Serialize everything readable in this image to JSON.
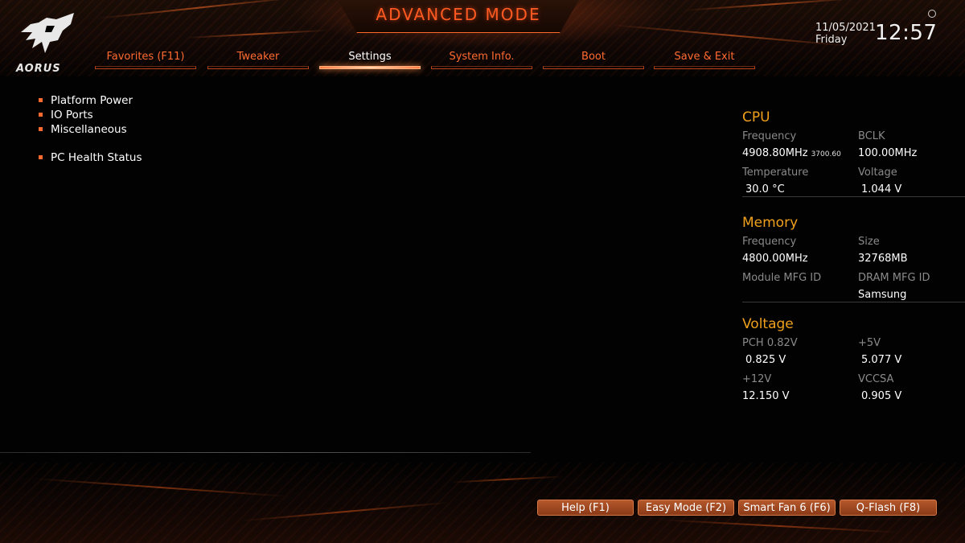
{
  "header": {
    "mode_title": "ADVANCED MODE",
    "brand": "AORUS",
    "date": "11/05/2021",
    "day": "Friday",
    "time": "12:57"
  },
  "tabs": [
    {
      "label": "Favorites (F11)",
      "active": false
    },
    {
      "label": "Tweaker",
      "active": false
    },
    {
      "label": "Settings",
      "active": true
    },
    {
      "label": "System Info.",
      "active": false
    },
    {
      "label": "Boot",
      "active": false
    },
    {
      "label": "Save & Exit",
      "active": false
    }
  ],
  "menu": {
    "items": [
      {
        "label": "Platform Power"
      },
      {
        "label": "IO Ports"
      },
      {
        "label": "Miscellaneous"
      },
      {
        "label": "PC Health Status"
      }
    ]
  },
  "panel": {
    "cpu": {
      "title": "CPU",
      "frequency_label": "Frequency",
      "frequency_value": "4908.80MHz",
      "frequency_sub": "3700.60",
      "bclk_label": "BCLK",
      "bclk_value": "100.00MHz",
      "temperature_label": "Temperature",
      "temperature_value": "30.0 °C",
      "voltage_label": "Voltage",
      "voltage_value": "1.044 V"
    },
    "memory": {
      "title": "Memory",
      "frequency_label": "Frequency",
      "frequency_value": "4800.00MHz",
      "size_label": "Size",
      "size_value": "32768MB",
      "module_mfg_label": "Module MFG ID",
      "module_mfg_value": "",
      "dram_mfg_label": "DRAM MFG ID",
      "dram_mfg_value": "Samsung"
    },
    "voltage": {
      "title": "Voltage",
      "pch_label": "PCH 0.82V",
      "pch_value": "0.825 V",
      "v5_label": "+5V",
      "v5_value": "5.077 V",
      "v12_label": "+12V",
      "v12_value": "12.150 V",
      "vccsa_label": "VCCSA",
      "vccsa_value": "0.905 V"
    }
  },
  "footer": {
    "help": "Help (F1)",
    "easy_mode": "Easy Mode (F2)",
    "smart_fan": "Smart Fan 6 (F6)",
    "qflash": "Q-Flash (F8)"
  },
  "colors": {
    "accent": "#ff6a30",
    "section_title": "#f0a01c",
    "label_gray": "#8a8a8a"
  }
}
